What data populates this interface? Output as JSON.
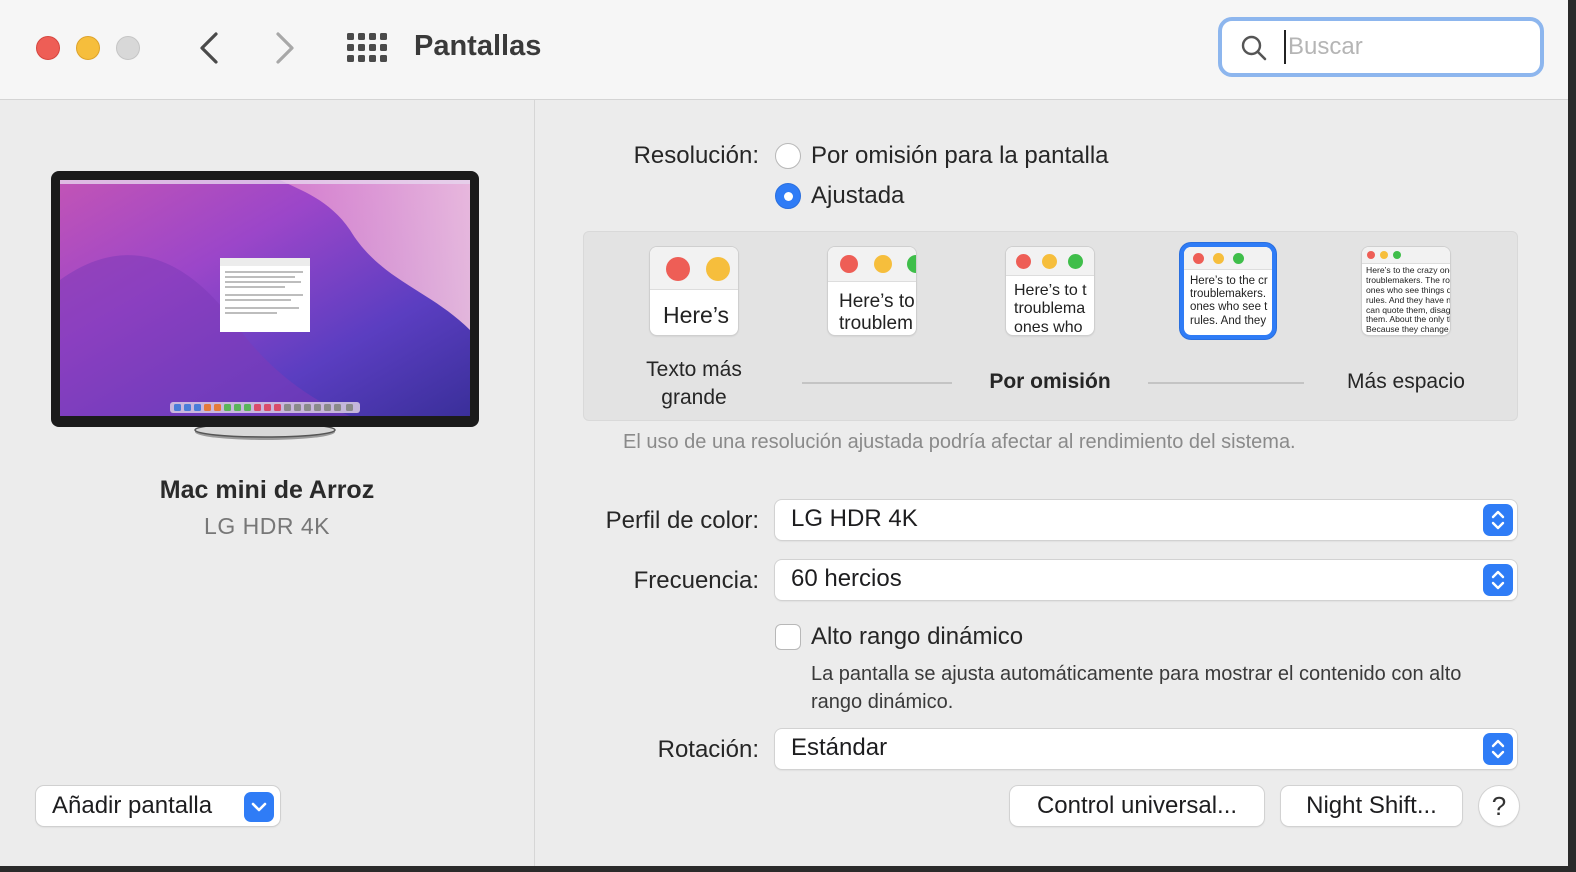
{
  "window": {
    "title": "Pantallas",
    "search": {
      "placeholder": "Buscar",
      "value": ""
    }
  },
  "sidebar": {
    "device_name": "Mac mini de Arroz",
    "device_model": "LG HDR 4K",
    "add_display_label": "Añadir pantalla"
  },
  "resolution": {
    "label": "Resolución:",
    "options": [
      {
        "label": "Por omisión para la pantalla",
        "selected": false
      },
      {
        "label": "Ajustada",
        "selected": true
      }
    ],
    "scale": {
      "left_label_line1": "Texto más",
      "left_label_line2": "grande",
      "center_label": "Por omisión",
      "right_label": "Más espacio",
      "selected_index": 3,
      "thumbnails": [
        {
          "text": "Here’s"
        },
        {
          "text": "Here’s to\ntroublem"
        },
        {
          "text": "Here’s to t\ntroublema\nones who"
        },
        {
          "text": "Here’s to the cr\ntroublemakers.\nones who see t\nrules. And they"
        },
        {
          "text": "Here’s to the crazy one\ntroublemakers. The rou\nones who see things dif\nrules. And they have no\ncan quote them, disagre\nthem. About the only th\nBecause they change th"
        }
      ]
    },
    "note": "El uso de una resolución ajustada podría afectar al rendimiento del sistema."
  },
  "color_profile": {
    "label": "Perfil de color:",
    "value": "LG HDR 4K"
  },
  "refresh": {
    "label": "Frecuencia:",
    "value": "60 hercios"
  },
  "hdr": {
    "label": "Alto rango dinámico",
    "checked": false,
    "description": "La pantalla se ajusta automáticamente para mostrar el contenido con alto rango dinámico."
  },
  "rotation": {
    "label": "Rotación:",
    "value": "Estándar"
  },
  "buttons": {
    "universal_control": "Control universal...",
    "night_shift": "Night Shift...",
    "help": "?"
  },
  "colors": {
    "accent": "#2f7cf6",
    "close": "#ee5e56",
    "minimize": "#f6be3c"
  }
}
